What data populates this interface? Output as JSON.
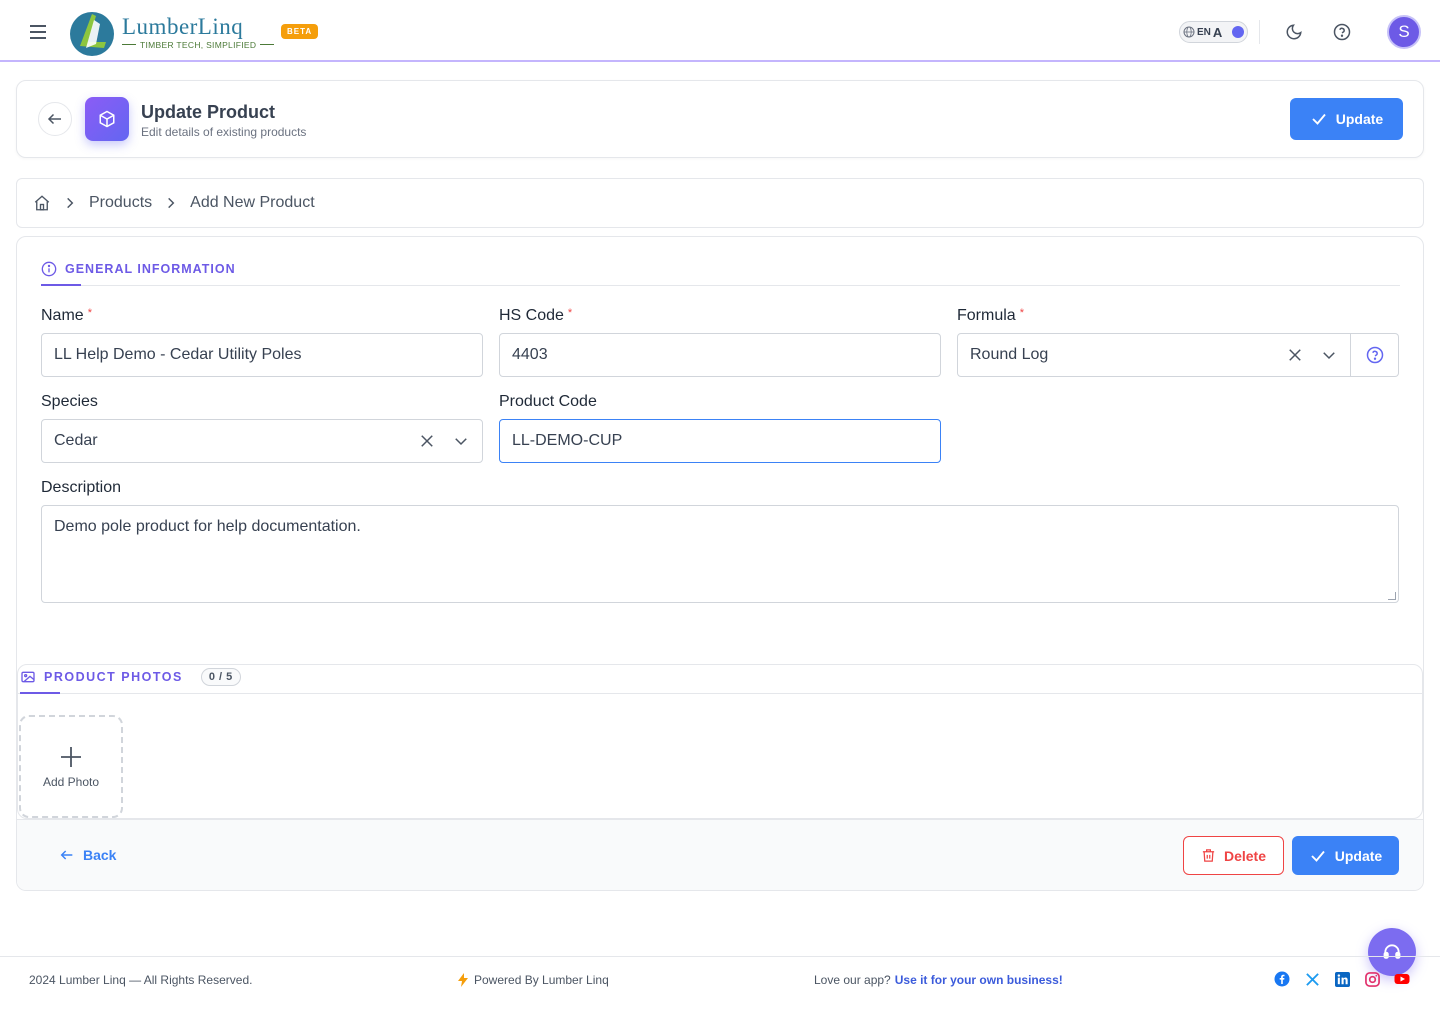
{
  "app": {
    "brand_name": "LumberLinq",
    "brand_tagline": "TIMBER TECH, SIMPLIFIED",
    "beta_badge": "BETA",
    "lang_code": "EN",
    "lang_alt": "A",
    "avatar_initial": "S"
  },
  "header": {
    "title": "Update Product",
    "subtitle": "Edit details of existing products",
    "update_label": "Update"
  },
  "breadcrumb": {
    "items": [
      "Products",
      "Add New Product"
    ]
  },
  "general": {
    "section_title": "GENERAL INFORMATION",
    "name_label": "Name",
    "name_value": "LL Help Demo - Cedar Utility Poles",
    "hs_label": "HS Code",
    "hs_value": "4403",
    "formula_label": "Formula",
    "formula_value": "Round Log",
    "species_label": "Species",
    "species_value": "Cedar",
    "product_code_label": "Product Code",
    "product_code_value": "LL-DEMO-CUP",
    "description_label": "Description",
    "description_value": "Demo pole product for help documentation.",
    "required_mark": "*"
  },
  "photos": {
    "section_title": "PRODUCT PHOTOS",
    "count": "0 / 5",
    "add_label": "Add Photo"
  },
  "actions": {
    "back_label": "Back",
    "delete_label": "Delete",
    "update_label": "Update"
  },
  "footer": {
    "copyright": "2024 Lumber Linq — All Rights Reserved.",
    "powered": "Powered By Lumber Linq",
    "love_text": "Love our app?",
    "love_link": "Use it for your own business!"
  },
  "colors": {
    "accent": "#6d5ae6",
    "primary_button": "#3b82f6",
    "danger": "#ef4444",
    "beta": "#f59e0b"
  },
  "icons": [
    "menu-icon",
    "globe-icon",
    "moon-icon",
    "help-circle-icon",
    "arrow-left-icon",
    "cube-icon",
    "check-icon",
    "home-icon",
    "chevron-right-icon",
    "info-icon",
    "close-icon",
    "chevron-down-icon",
    "image-icon",
    "plus-icon",
    "trash-icon",
    "headset-icon",
    "bolt-icon",
    "facebook-icon",
    "x-icon",
    "linkedin-icon",
    "instagram-icon",
    "youtube-icon"
  ]
}
